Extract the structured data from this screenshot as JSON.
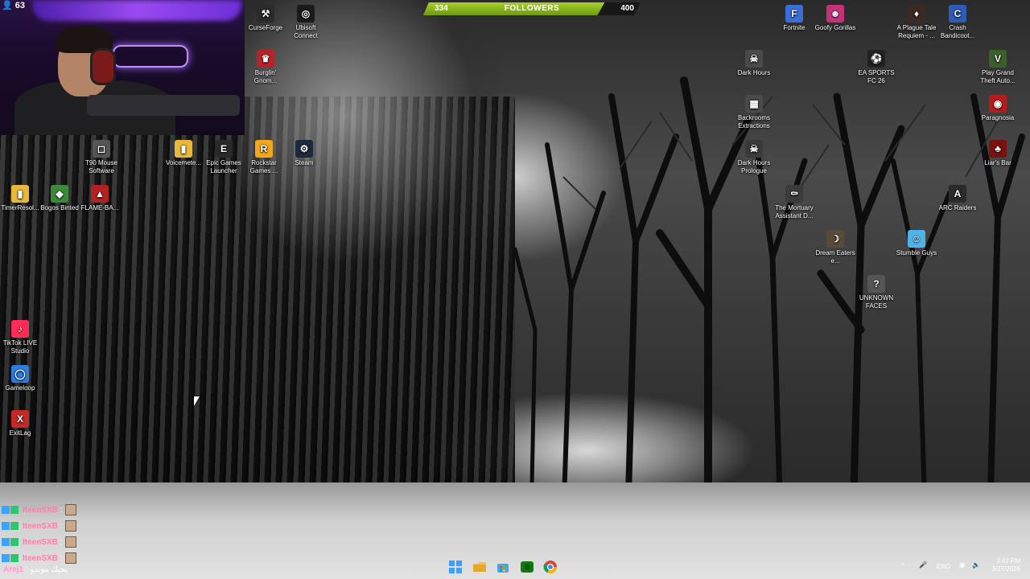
{
  "stream": {
    "viewer_count": "63",
    "followers": {
      "current": "334",
      "label": "FOLLOWERS",
      "goal": "400",
      "progress": 0.835
    }
  },
  "desktop_icons": [
    {
      "label": "CurseForge",
      "icon": "curseforge-icon",
      "color": "#2b2b2b"
    },
    {
      "label": "Ubisoft Connect",
      "icon": "ubisoft-icon",
      "color": "#1b1b1b"
    },
    {
      "label": "Burglin' Gnom...",
      "icon": "burglin-gnomes-icon",
      "color": "#b8232a"
    },
    {
      "label": "T90 Mouse Software",
      "icon": "mouse-software-icon",
      "color": "#555"
    },
    {
      "label": "Voicemete...",
      "icon": "folder-icon",
      "color": "#e8b83a"
    },
    {
      "label": "Epic Games Launcher",
      "icon": "epic-games-icon",
      "color": "#2a2a2a"
    },
    {
      "label": "Rockstar Games ...",
      "icon": "rockstar-icon",
      "color": "#f2a71b"
    },
    {
      "label": "Steam",
      "icon": "steam-icon",
      "color": "#1b2a3d"
    },
    {
      "label": "TimerResol...",
      "icon": "folder-icon",
      "color": "#e8b83a"
    },
    {
      "label": "Bogos Binted",
      "icon": "bogos-binted-icon",
      "color": "#3a8a3a"
    },
    {
      "label": "FLAME-BA...",
      "icon": "flame-ba-icon",
      "color": "#b22222"
    },
    {
      "label": "TikTok LIVE Studio",
      "icon": "tiktok-live-icon",
      "color": "#ff2d55"
    },
    {
      "label": "Gameloop",
      "icon": "gameloop-icon",
      "color": "#2a7de1"
    },
    {
      "label": "ExitLag",
      "icon": "exitlag-icon",
      "color": "#c62828"
    },
    {
      "label": "Fortnite",
      "icon": "fortnite-icon",
      "color": "#3a6fd8"
    },
    {
      "label": "Goofy Gorillas",
      "icon": "goofy-gorillas-icon",
      "color": "#c2337a"
    },
    {
      "label": "A Plague Tale Requiem - ...",
      "icon": "plague-tale-icon",
      "color": "#3b2a24"
    },
    {
      "label": "Crash Bandicoot...",
      "icon": "crash-bandicoot-icon",
      "color": "#2d5bb5"
    },
    {
      "label": "Dark Hours",
      "icon": "dark-hours-icon",
      "color": "#4a4a4a"
    },
    {
      "label": "EA SPORTS FC 26",
      "icon": "ea-fc-icon",
      "color": "#222"
    },
    {
      "label": "Play Grand Theft Auto...",
      "icon": "gta-icon",
      "color": "#3a5f2a"
    },
    {
      "label": "Backrooms Extractions",
      "icon": "backrooms-icon",
      "color": "#4a4a4a"
    },
    {
      "label": "Paragnosia",
      "icon": "paragnosia-icon",
      "color": "#b71c1c"
    },
    {
      "label": "Dark Hours Prologue",
      "icon": "dark-hours-prologue-icon",
      "color": "#3a3a3a"
    },
    {
      "label": "Liar's Bar",
      "icon": "liars-bar-icon",
      "color": "#7a1111"
    },
    {
      "label": "The Mortuary Assistant D...",
      "icon": "mortuary-icon",
      "color": "#3b3b3b"
    },
    {
      "label": "ARC Raiders",
      "icon": "arc-raiders-icon",
      "color": "#2b2b2b"
    },
    {
      "label": "Dream Eaters e...",
      "icon": "dream-eaters-icon",
      "color": "#5a4a3a"
    },
    {
      "label": "Stumble Guys",
      "icon": "stumble-guys-icon",
      "color": "#4fb3e8"
    },
    {
      "label": "UNKNOWN FACES",
      "icon": "unknown-faces-icon",
      "color": "#555"
    }
  ],
  "chat": {
    "messages": [
      {
        "user": "IteenSXB",
        "sep": ":"
      },
      {
        "user": "IteenSXB",
        "sep": ":"
      },
      {
        "user": "IteenSXB",
        "sep": ":"
      },
      {
        "user": "IteenSXB",
        "sep": ":"
      }
    ],
    "last": {
      "user": "Arej1",
      "sep": ":",
      "text": "يحيك مويدو"
    }
  },
  "taskbar": {
    "apps": [
      "windows-start-icon",
      "file-explorer-icon",
      "store-icon",
      "xbox-icon",
      "chrome-icon",
      "settings-icon"
    ],
    "tray": {
      "language": "ENG",
      "time": "3:42 PM",
      "date": "3/27/2026"
    }
  }
}
